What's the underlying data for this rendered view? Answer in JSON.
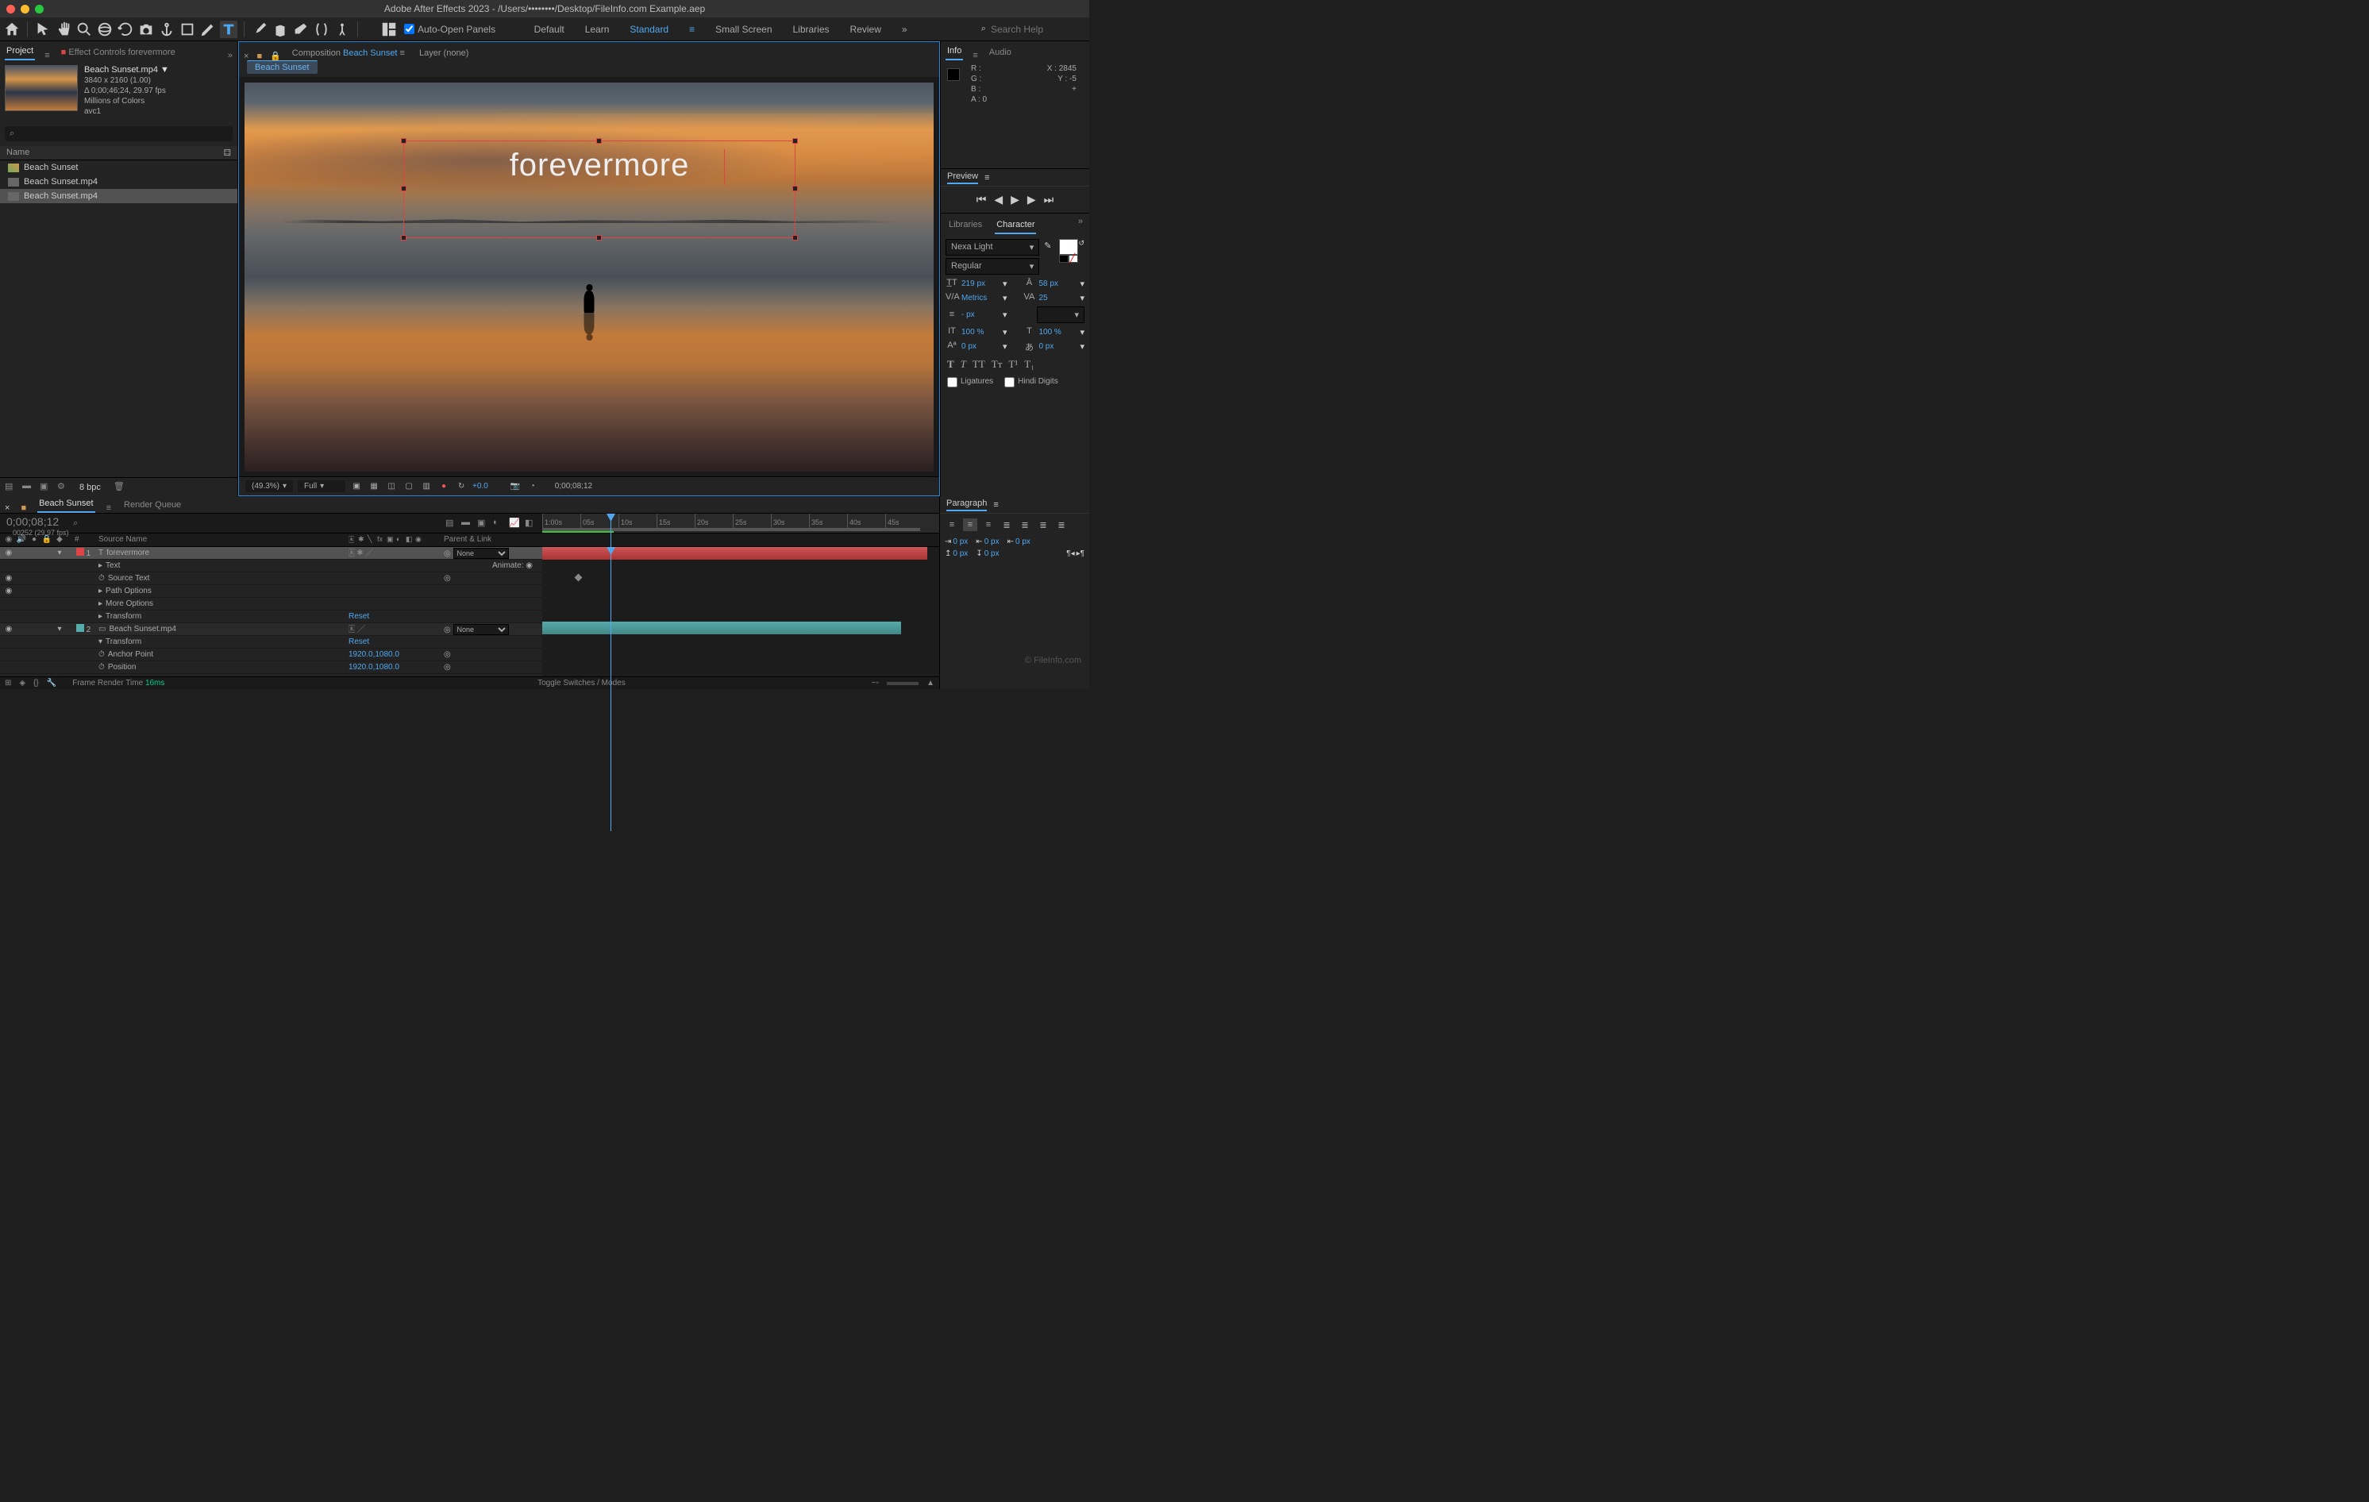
{
  "titlebar": {
    "title": "Adobe After Effects 2023 - /Users/••••••••/Desktop/FileInfo.com Example.aep"
  },
  "toolbar": {
    "autoOpen": "Auto-Open Panels",
    "workspaces": [
      "Default",
      "Learn",
      "Standard",
      "Small Screen",
      "Libraries",
      "Review"
    ],
    "searchPlaceholder": "Search Help"
  },
  "project": {
    "tabProject": "Project",
    "tabEffect": "Effect Controls forevermore",
    "assetName": "Beach Sunset.mp4 ▼",
    "dims": "3840 x 2160 (1.00)",
    "duration": "Δ 0;00;46;24, 29.97 fps",
    "colors": "Millions of Colors",
    "codec": "avc1",
    "search": "⌕",
    "colName": "Name",
    "items": [
      "Beach Sunset",
      "Beach Sunset.mp4",
      "Beach Sunset.mp4"
    ],
    "bpc": "8 bpc"
  },
  "composition": {
    "tabPrefix": "Composition",
    "compName": "Beach Sunset",
    "layerTab": "Layer (none)",
    "subtab": "Beach Sunset",
    "textContent": "forevermore",
    "zoom": "(49.3%)",
    "resolution": "Full",
    "exposure": "+0.0",
    "timecode": "0;00;08;12"
  },
  "info": {
    "tabInfo": "Info",
    "tabAudio": "Audio",
    "R": "R :",
    "G": "G :",
    "B": "B :",
    "A": "A :  0",
    "X": "X : 2845",
    "Y": "Y :   -5",
    "plus": "+"
  },
  "preview": {
    "title": "Preview"
  },
  "character": {
    "tabLib": "Libraries",
    "tabChar": "Character",
    "font": "Nexa Light",
    "style": "Regular",
    "size": "219 px",
    "leading": "58 px",
    "kerning": "Metrics",
    "tracking": "25",
    "stroke": "- px",
    "vscale": "100 %",
    "hscale": "100 %",
    "baseline": "0 px",
    "tsume": "0 px",
    "ligatures": "Ligatures",
    "hindi": "Hindi Digits"
  },
  "timeline": {
    "tab": "Beach Sunset",
    "renderQueue": "Render Queue",
    "timecode": "0;00;08;12",
    "frames": "00252 (29.97 fps)",
    "colNum": "#",
    "colSource": "Source Name",
    "colParent": "Parent & Link",
    "rulerTicks": [
      "1:00s",
      "05s",
      "10s",
      "15s",
      "20s",
      "25s",
      "30s",
      "35s",
      "40s",
      "45s"
    ],
    "layers": [
      {
        "num": "1",
        "name": "forevermore",
        "type": "T",
        "color": "#d44",
        "parent": "None"
      },
      {
        "num": "2",
        "name": "Beach Sunset.mp4",
        "type": "V",
        "color": "#5aa",
        "parent": "None"
      }
    ],
    "props": {
      "text": "Text",
      "animate": "Animate:",
      "sourceText": "Source Text",
      "pathOptions": "Path Options",
      "moreOptions": "More Options",
      "transform": "Transform",
      "reset": "Reset",
      "anchor": "Anchor Point",
      "position": "Position",
      "anchorVal": "1920.0,1080.0",
      "posVal": "1920.0,1080.0"
    },
    "frametime": "Frame Render Time",
    "frametimeVal": "16ms",
    "toggles": "Toggle Switches / Modes"
  },
  "paragraph": {
    "title": "Paragraph",
    "indentL": "0 px",
    "indentR": "0 px",
    "indentF": "0 px",
    "spaceBefore": "0 px",
    "spaceAfter": "0 px"
  },
  "watermark": "© FileInfo.com"
}
